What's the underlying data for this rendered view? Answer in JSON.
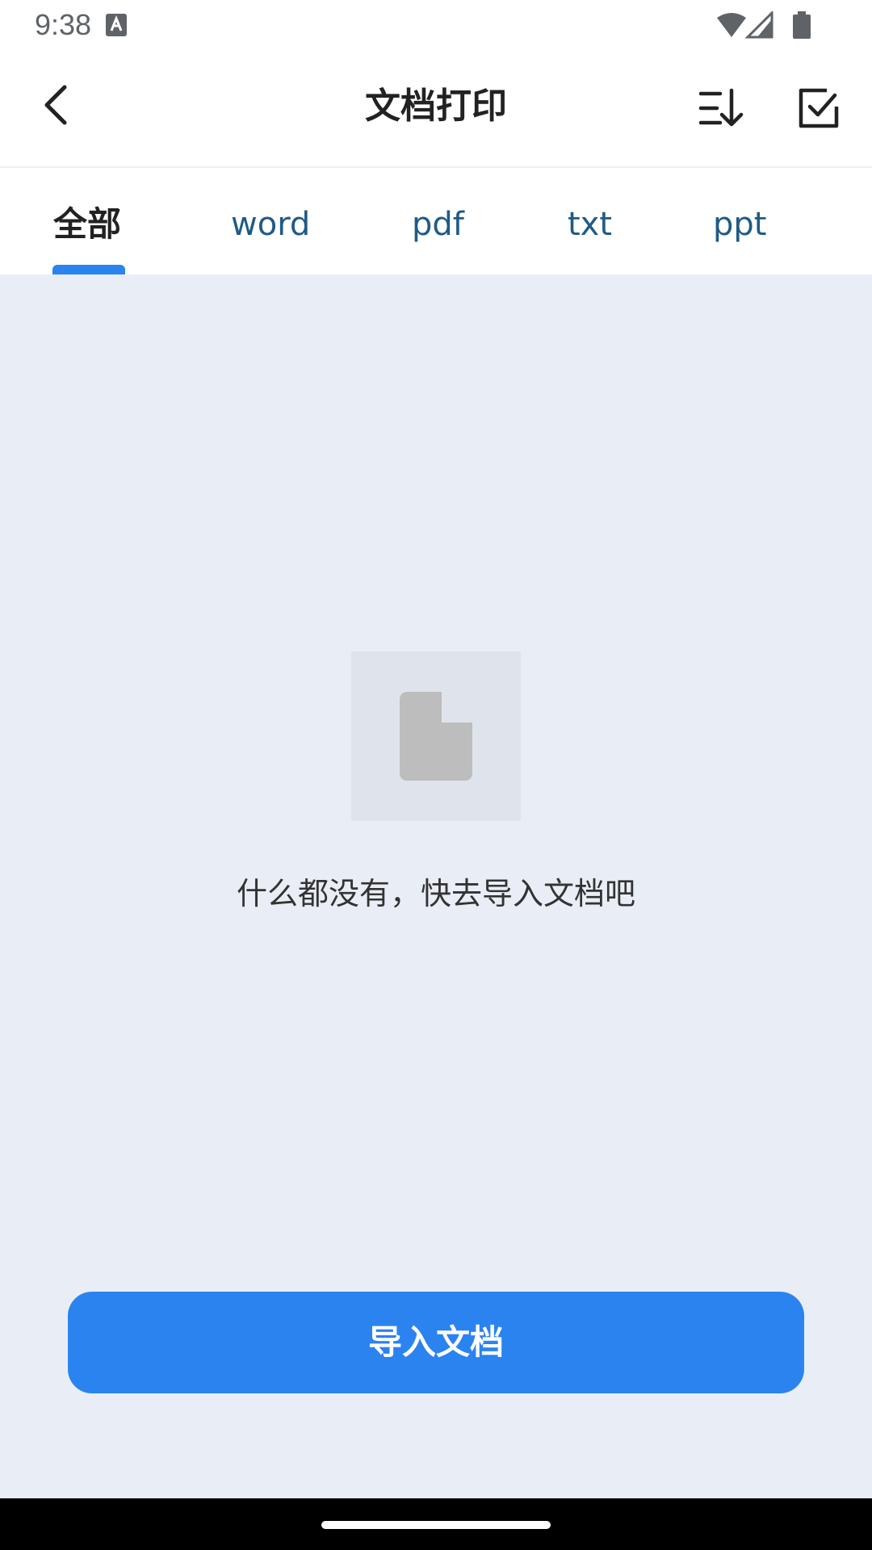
{
  "status_bar": {
    "time": "9:38",
    "icons": [
      "text-a-icon",
      "wifi-icon",
      "signal-icon",
      "battery-icon"
    ]
  },
  "header": {
    "title": "文档打印",
    "icons": [
      "back-arrow-icon",
      "sort-icon",
      "checkbox-icon"
    ]
  },
  "tabs": [
    {
      "label": "全部",
      "active": true
    },
    {
      "label": "word",
      "active": false
    },
    {
      "label": "pdf",
      "active": false
    },
    {
      "label": "txt",
      "active": false
    },
    {
      "label": "ppt",
      "active": false
    }
  ],
  "empty_state": {
    "icon": "file-icon",
    "message": "什么都没有，快去导入文档吧"
  },
  "actions": {
    "import_label": "导入文档"
  },
  "colors": {
    "accent": "#2b83f0",
    "content_background": "#e9eef6",
    "tab_text": "#1f5a86"
  }
}
